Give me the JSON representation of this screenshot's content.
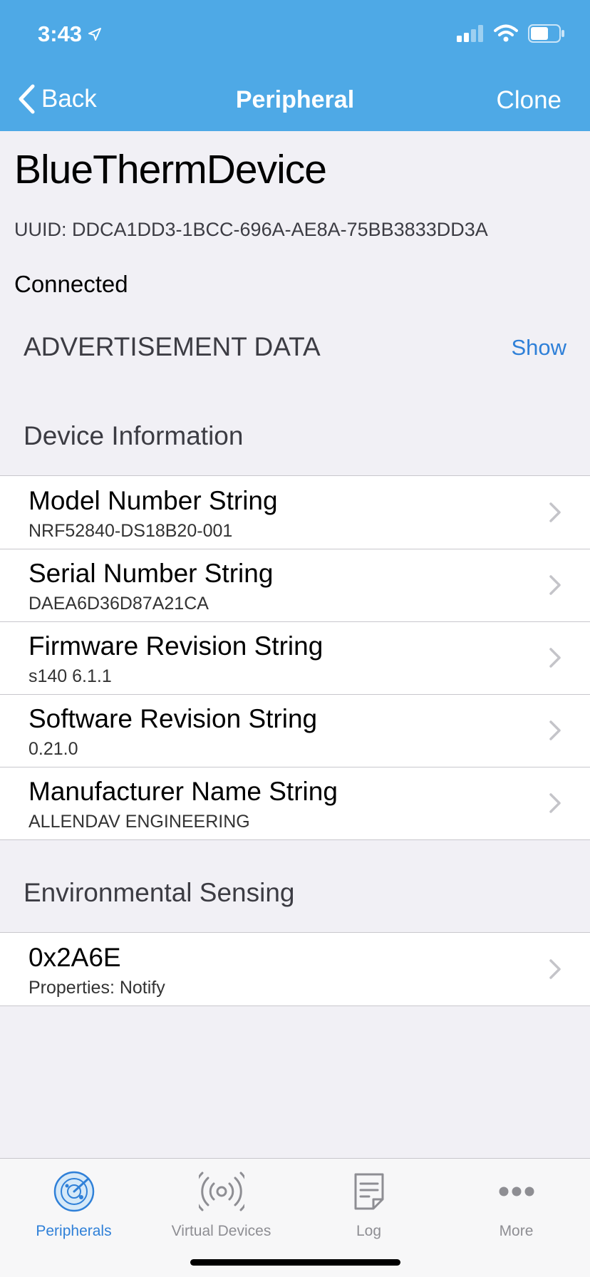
{
  "status": {
    "time": "3:43"
  },
  "nav": {
    "back_label": "Back",
    "title": "Peripheral",
    "clone_label": "Clone"
  },
  "device": {
    "name": "BlueThermDevice",
    "uuid": "UUID: DDCA1DD3-1BCC-696A-AE8A-75BB3833DD3A",
    "state": "Connected"
  },
  "advertisement": {
    "title": "ADVERTISEMENT DATA",
    "action": "Show"
  },
  "sections": [
    {
      "title": "Device Information",
      "rows": [
        {
          "title": "Model Number String",
          "subtitle": "NRF52840-DS18B20-001"
        },
        {
          "title": "Serial Number String",
          "subtitle": "DAEA6D36D87A21CA"
        },
        {
          "title": "Firmware Revision String",
          "subtitle": "s140 6.1.1"
        },
        {
          "title": "Software Revision String",
          "subtitle": "0.21.0"
        },
        {
          "title": "Manufacturer Name String",
          "subtitle": "ALLENDAV ENGINEERING"
        }
      ]
    },
    {
      "title": "Environmental Sensing",
      "rows": [
        {
          "title": "0x2A6E",
          "subtitle": "Properties: Notify"
        }
      ]
    }
  ],
  "tabs": [
    {
      "label": "Peripherals",
      "icon": "radar-icon",
      "active": true
    },
    {
      "label": "Virtual Devices",
      "icon": "broadcast-icon",
      "active": false
    },
    {
      "label": "Log",
      "icon": "log-icon",
      "active": false
    },
    {
      "label": "More",
      "icon": "more-icon",
      "active": false
    }
  ],
  "colors": {
    "accent": "#4ea9e6",
    "link": "#2f80d8",
    "inactive": "#8e8e93"
  }
}
